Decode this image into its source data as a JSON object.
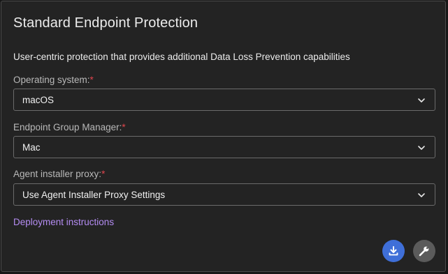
{
  "card": {
    "title": "Standard Endpoint Protection",
    "description": "User-centric protection that provides additional Data Loss Prevention capabilities",
    "required_marker": "*"
  },
  "fields": {
    "os": {
      "label": "Operating system:",
      "value": "macOS"
    },
    "group": {
      "label": "Endpoint Group Manager:",
      "value": "Mac"
    },
    "proxy": {
      "label": "Agent installer proxy:",
      "value": "Use Agent Installer Proxy Settings"
    }
  },
  "link": {
    "text": "Deployment instructions"
  },
  "actions": {
    "download_icon": "download-icon",
    "settings_icon": "wrench-icon"
  },
  "colors": {
    "background": "#232323",
    "border": "#6b6b6b",
    "required": "#e0454d",
    "link": "#b48cf2",
    "primary_button": "#3f6fd8",
    "secondary_button": "#5b5b5b"
  }
}
